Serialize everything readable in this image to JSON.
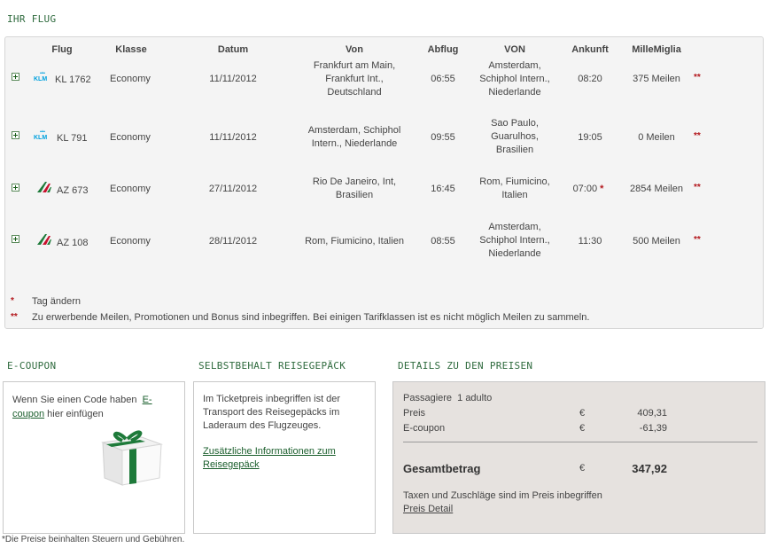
{
  "flight_section": {
    "title": "IHR FLUG",
    "headers": {
      "flug": "Flug",
      "klasse": "Klasse",
      "datum": "Datum",
      "von": "Von",
      "abflug": "Abflug",
      "nach": "VON",
      "ankunft": "Ankunft",
      "millemiglia": "MilleMiglia"
    },
    "rows": [
      {
        "airline": "KLM",
        "flight": "KL 1762",
        "class": "Economy",
        "date": "11/11/2012",
        "from": [
          "Frankfurt am Main,",
          "Frankfurt Int.,",
          "Deutschland"
        ],
        "dep": "06:55",
        "to": [
          "Amsterdam,",
          "Schiphol Intern.,",
          "Niederlande"
        ],
        "arr": "08:20",
        "arr_note": "",
        "miles": "375 Meilen",
        "miles_note": "**"
      },
      {
        "airline": "KLM",
        "flight": "KL 791",
        "class": "Economy",
        "date": "11/11/2012",
        "from": [
          "Amsterdam, Schiphol",
          "Intern., Niederlande"
        ],
        "dep": "09:55",
        "to": [
          "Sao Paulo,",
          "Guarulhos,",
          "Brasilien"
        ],
        "arr": "19:05",
        "arr_note": "",
        "miles": "0 Meilen",
        "miles_note": "**"
      },
      {
        "airline": "Alitalia",
        "flight": "AZ 673",
        "class": "Economy",
        "date": "27/11/2012",
        "from": [
          "Rio De Janeiro, Int,",
          "Brasilien"
        ],
        "dep": "16:45",
        "to": [
          "Rom, Fiumicino,",
          "Italien"
        ],
        "arr": "07:00",
        "arr_note": "*",
        "miles": "2854 Meilen",
        "miles_note": "**"
      },
      {
        "airline": "Alitalia",
        "flight": "AZ 108",
        "class": "Economy",
        "date": "28/11/2012",
        "from": [
          "Rom, Fiumicino, Italien"
        ],
        "dep": "08:55",
        "to": [
          "Amsterdam,",
          "Schiphol Intern.,",
          "Niederlande"
        ],
        "arr": "11:30",
        "arr_note": "",
        "miles": "500 Meilen",
        "miles_note": "**"
      }
    ],
    "notes": [
      {
        "mark": "*",
        "text": "Tag ändern"
      },
      {
        "mark": "**",
        "text": "Zu erwerbende Meilen, Promotionen und Bonus sind inbegriffen. Bei einigen Tarifklassen ist es nicht möglich Meilen zu sammeln."
      }
    ]
  },
  "ecoupon": {
    "title": "E-COUPON",
    "text_before": "Wenn Sie einen Code haben",
    "link_part1": "E-",
    "link_part2": "coupon",
    "text_after": "hier einfügen",
    "icon": "gift-box-icon"
  },
  "baggage": {
    "title": "SELBSTBEHALT REISEGEPÄCK",
    "lines": [
      "Im Ticketpreis inbegriffen ist der",
      "Transport des Reisegepäcks im",
      "Laderaum des Flugzeuges."
    ],
    "link_lines": [
      "Zusätzliche Informationen zum",
      "Reisegepäck"
    ]
  },
  "prices": {
    "title": "DETAILS ZU DEN PREISEN",
    "passengers": "Passagiere  1 adulto",
    "rows": [
      {
        "label": "Preis",
        "currency": "€",
        "value": "409,31"
      },
      {
        "label": "E-coupon",
        "currency": "€",
        "value": "-61,39"
      }
    ],
    "total": {
      "label": "Gesamtbetrag",
      "currency": "€",
      "value": "347,92"
    },
    "note": "Taxen und Zuschläge sind im Preis inbegriffen",
    "detail_link": "Preis Detail"
  },
  "footer_note": "*Die Preise beinhalten Steuern und Gebühren.",
  "colors": {
    "accent_green": "#2f6b3e",
    "star_red": "#b3171c",
    "klm_blue": "#00a1de",
    "alitalia_green": "#1e7a3a"
  }
}
